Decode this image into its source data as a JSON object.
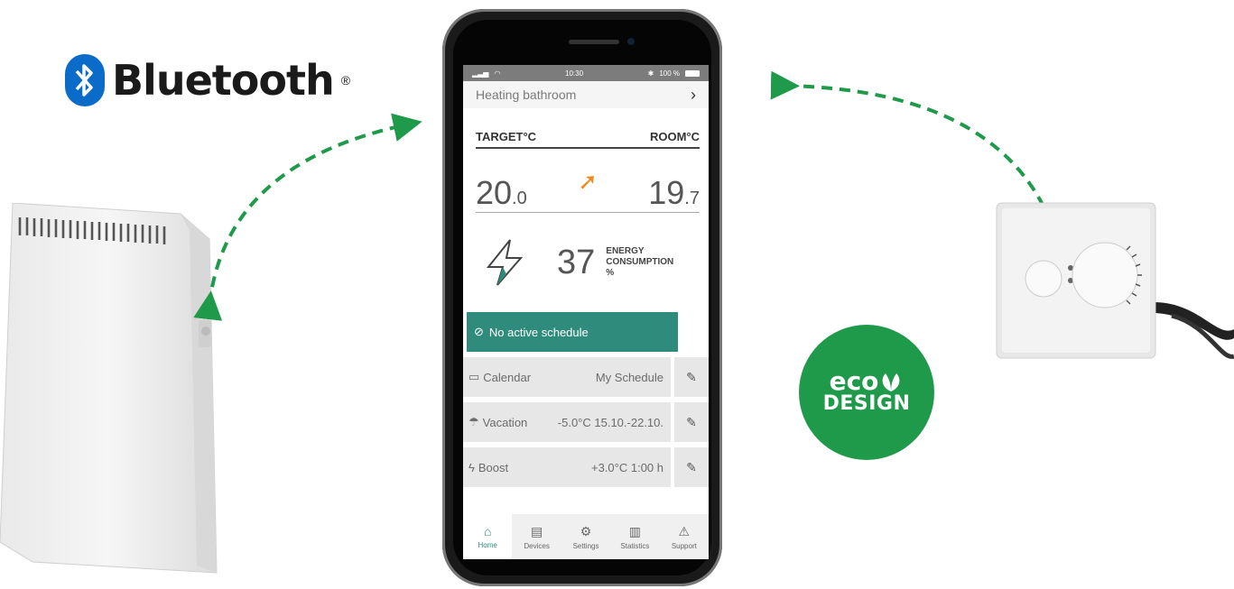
{
  "branding": {
    "bluetooth_text": "Bluetooth",
    "bluetooth_reg": "®",
    "eco_top": "eco",
    "eco_bottom": "DESIGN"
  },
  "colors": {
    "accent_green": "#2f8c7c",
    "arrow_green": "#1f9a4a",
    "bluetooth_blue": "#0a6cc8",
    "trend_orange": "#f08a1c"
  },
  "status_bar": {
    "time": "10:30",
    "battery": "100 %"
  },
  "header": {
    "title": "Heating bathroom",
    "chevron": "›"
  },
  "temps": {
    "target_label": "TARGET°C",
    "room_label": "ROOM°C",
    "target_int": "20",
    "target_dec": ".0",
    "room_int": "19",
    "room_dec": ".7",
    "trend_icon": "arrow-up-right-icon"
  },
  "energy": {
    "value": "37",
    "label_line1": "ENERGY",
    "label_line2": "CONSUMPTION",
    "label_line3": "%"
  },
  "schedule": {
    "label": "No active schedule"
  },
  "rows": [
    {
      "label": "Calendar",
      "value": "My Schedule",
      "icon": "calendar-icon"
    },
    {
      "label": "Vacation",
      "value": "-5.0°C 15.10.-22.10.",
      "icon": "umbrella-icon"
    },
    {
      "label": "Boost",
      "value": "+3.0°C 1:00 h",
      "icon": "bolt-icon"
    }
  ],
  "nav": [
    {
      "label": "Home",
      "icon": "home-icon",
      "active": true
    },
    {
      "label": "Devices",
      "icon": "devices-icon"
    },
    {
      "label": "Settings",
      "icon": "gear-icon"
    },
    {
      "label": "Statistics",
      "icon": "chart-icon"
    },
    {
      "label": "Support",
      "icon": "warning-icon"
    }
  ]
}
